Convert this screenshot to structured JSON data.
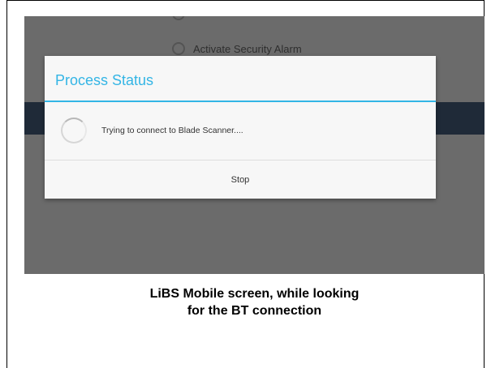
{
  "screen": {
    "options": {
      "partial_label": "",
      "alarm_label": "Activate Security Alarm"
    },
    "dialog": {
      "title": "Process Status",
      "message": "Trying to connect to Blade Scanner....",
      "stop_label": "Stop"
    }
  },
  "caption": {
    "line1": "LiBS Mobile screen, while looking",
    "line2": "for the BT connection"
  },
  "colors": {
    "accent": "#33b5e5",
    "overlay": "#6b6b6b",
    "dialog_background": "#f7f7f7",
    "action_bar": "#1f2a38"
  },
  "icons": {
    "option_radio": "radio-unchecked-icon",
    "progress": "loading-spinner-icon"
  }
}
